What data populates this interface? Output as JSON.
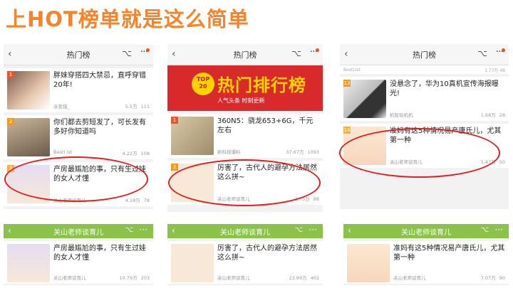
{
  "headline": "上HOT榜单就是这么简单",
  "panel1": {
    "nav_title": "热门榜",
    "items": [
      {
        "rank": "1",
        "title": "胖妹穿搭四大禁忌，直呼穿错20年!",
        "author": "亲爱猎_",
        "views": "5.5万",
        "likes": "111"
      },
      {
        "rank": "2",
        "title": "你们都去剪短发了，可长发有多好你知道吗",
        "author": "Bestl ist",
        "views": "4.22万",
        "likes": "108"
      },
      {
        "rank": "3",
        "title": "产房最尴尬的事，只有生过娃的女人才懂",
        "author": "关山老师谈育儿",
        "views": "4.18万",
        "likes": "78"
      }
    ]
  },
  "panel2": {
    "nav_title": "热门榜",
    "banner_badge": "TOP 20",
    "banner_title": "热门排行榜",
    "banner_sub": "人气头条  时刻更新",
    "items": [
      {
        "rank": "1",
        "title": "360N5：骁龙653+6G，千元左右",
        "author": "新科技爆料",
        "views": "37.67万",
        "likes": "1093"
      },
      {
        "rank": "2",
        "title": "厉害了，古代人的避孕方法居然这么拼~",
        "author": "关山老师谈育儿",
        "views": "2.75万",
        "likes": "88"
      }
    ]
  },
  "panel3": {
    "nav_title": "热门榜",
    "cut_author": "BestList",
    "cut_views": "1.77万",
    "cut_likes": "48",
    "items": [
      {
        "rank": "13",
        "title": "没悬念了，华为10真机宣传海报曝光!",
        "author": "机智玩机机",
        "views": "1.68万",
        "likes": "28"
      },
      {
        "rank": "14",
        "title": "准妈有这5种情况易产唐氏儿，尤其第一种",
        "author": "关山老师谈育儿",
        "views": "1.47万",
        "likes": "50"
      }
    ]
  },
  "bottom1": {
    "bar_title": "关山老师谈育儿",
    "title": "产房最尴尬的事，只有生过娃的女人才懂",
    "author": "关山老师谈育儿",
    "views": "10.79万",
    "likes": "203"
  },
  "bottom2": {
    "bar_title": "关山老师谈育儿",
    "title": "厉害了，古代人的避孕方法居然这么拼~",
    "author": "关山老师谈育儿",
    "views": "23.89万",
    "likes": "402"
  },
  "bottom3": {
    "bar_title": "关山老师谈育儿",
    "title": "准妈有这5种情况易产唐氏儿，尤其第一种",
    "author": "关山老师谈育儿",
    "views": "7.07万",
    "likes": "90"
  },
  "colors": {
    "headline": "#f7842a",
    "highlight": "#e02020",
    "green_bar": "#8bc34a",
    "banner": "#d82a2a"
  }
}
